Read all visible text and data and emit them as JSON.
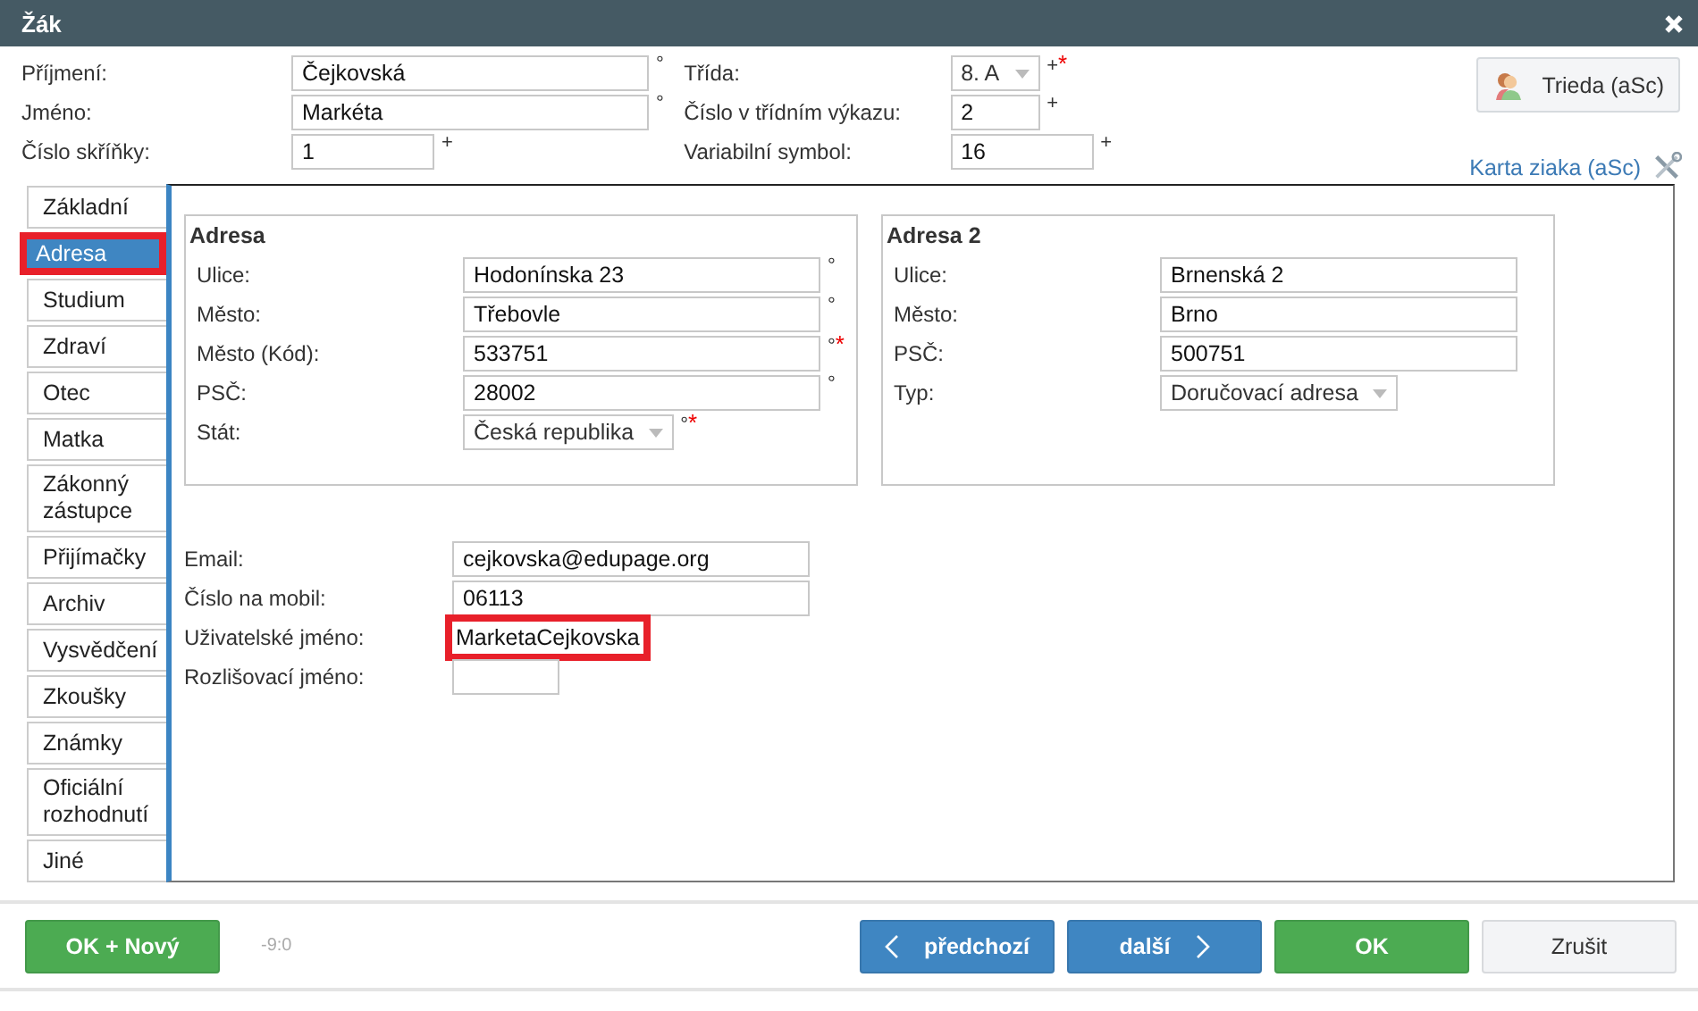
{
  "window": {
    "title": "Žák"
  },
  "header_left": [
    {
      "label": "Příjmení:",
      "value": "Čejkovská",
      "kind": "text",
      "mark": "°"
    },
    {
      "label": "Jméno:",
      "value": "Markéta",
      "kind": "text",
      "mark": "°"
    },
    {
      "label": "Číslo skříňky:",
      "value": "1",
      "kind": "text",
      "mark": "+"
    }
  ],
  "header_right": [
    {
      "label": "Třída:",
      "value": "8. A",
      "kind": "select",
      "mark": "+",
      "req": "*"
    },
    {
      "label": "Číslo v třídním výkazu:",
      "value": "2",
      "kind": "text",
      "mark": "+"
    },
    {
      "label": "Variabilní symbol:",
      "value": "16",
      "kind": "text",
      "mark": "+"
    }
  ],
  "class_button": {
    "label": "Trieda (aSc)"
  },
  "card_link": {
    "label": "Karta ziaka (aSc)"
  },
  "tabs": [
    {
      "label": "Základní",
      "selected": false,
      "highlighted": false
    },
    {
      "label": "Adresa",
      "selected": true,
      "highlighted": true
    },
    {
      "label": "Studium",
      "selected": false,
      "highlighted": false
    },
    {
      "label": "Zdraví",
      "selected": false,
      "highlighted": false
    },
    {
      "label": "Otec",
      "selected": false,
      "highlighted": false
    },
    {
      "label": "Matka",
      "selected": false,
      "highlighted": false
    },
    {
      "label": "Zákonný zástupce",
      "selected": false,
      "highlighted": false
    },
    {
      "label": "Přijímačky",
      "selected": false,
      "highlighted": false
    },
    {
      "label": "Archiv",
      "selected": false,
      "highlighted": false
    },
    {
      "label": "Vysvědčení",
      "selected": false,
      "highlighted": false
    },
    {
      "label": "Zkoušky",
      "selected": false,
      "highlighted": false
    },
    {
      "label": "Známky",
      "selected": false,
      "highlighted": false
    },
    {
      "label": "Oficiální rozhodnutí",
      "selected": false,
      "highlighted": false
    },
    {
      "label": "Jiné",
      "selected": false,
      "highlighted": false
    }
  ],
  "address_groups": [
    {
      "title": "Adresa",
      "fields": [
        {
          "label": "Ulice:",
          "value": "Hodonínska 23",
          "kind": "text",
          "mark": "°"
        },
        {
          "label": "Město:",
          "value": "Třebovle",
          "kind": "text",
          "mark": "°"
        },
        {
          "label": "Město (Kód):",
          "value": "533751",
          "kind": "text",
          "mark": "°",
          "req": "*"
        },
        {
          "label": "PSČ:",
          "value": "28002",
          "kind": "text",
          "mark": "°"
        },
        {
          "label": "Stát:",
          "value": "Česká republika",
          "kind": "select",
          "mark": "°",
          "req": "*"
        }
      ]
    },
    {
      "title": "Adresa 2",
      "fields": [
        {
          "label": "Ulice:",
          "value": "Brnenská 2",
          "kind": "text"
        },
        {
          "label": "Město:",
          "value": "Brno",
          "kind": "text"
        },
        {
          "label": "PSČ:",
          "value": "500751",
          "kind": "text"
        },
        {
          "label": "Typ:",
          "value": "Doručovací adresa",
          "kind": "select"
        }
      ]
    }
  ],
  "contact_fields": [
    {
      "label": "Email:",
      "value": "cejkovska@edupage.org",
      "highlighted": false
    },
    {
      "label": "Číslo na mobil:",
      "value": "06113",
      "highlighted": false
    },
    {
      "label": "Uživatelské jméno:",
      "value": "MarketaCejkovska",
      "highlighted": true
    },
    {
      "label": "Rozlišovací jméno:",
      "highlighted": false
    }
  ],
  "footer": {
    "left_button": "OK + Nový",
    "counter": "-9:0",
    "buttons": [
      {
        "label": "předchozí",
        "kind": "prev"
      },
      {
        "label": "další",
        "kind": "next"
      },
      {
        "label": "OK",
        "kind": "ok"
      },
      {
        "label": "Zrušit",
        "kind": "cancel"
      }
    ]
  }
}
